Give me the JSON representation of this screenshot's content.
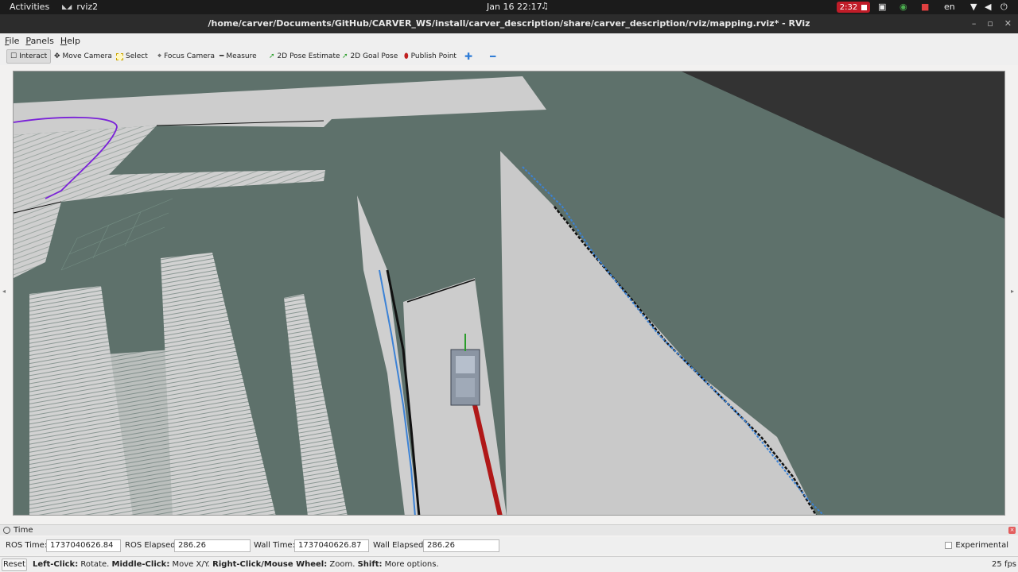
{
  "topbar": {
    "activities": "Activities",
    "app_name": "rviz2",
    "clock": "Jan 16  22:17",
    "recording": "2:32",
    "language": "en"
  },
  "window": {
    "title": "/home/carver/Documents/GitHub/CARVER_WS/install/carver_description/share/carver_description/rviz/mapping.rviz* - RViz"
  },
  "menubar": {
    "file": "File",
    "panels": "Panels",
    "help": "Help"
  },
  "toolbar": {
    "interact": "Interact",
    "move_camera": "Move Camera",
    "select": "Select",
    "focus_camera": "Focus Camera",
    "measure": "Measure",
    "pose_estimate": "2D Pose Estimate",
    "goal_pose": "2D Goal Pose",
    "publish_point": "Publish Point"
  },
  "time_panel": {
    "header": "Time",
    "ros_time_label": "ROS Time:",
    "ros_time": "1737040626.84",
    "ros_elapsed_label": "ROS Elapsed:",
    "ros_elapsed": "286.26",
    "wall_time_label": "Wall Time:",
    "wall_time": "1737040626.87",
    "wall_elapsed_label": "Wall Elapsed:",
    "wall_elapsed": "286.26",
    "experimental": "Experimental"
  },
  "statusbar": {
    "reset": "Reset",
    "left_click": "Left-Click:",
    "left_action": " Rotate. ",
    "middle_click": "Middle-Click:",
    "middle_action": " Move X/Y. ",
    "right_click": "Right-Click/Mouse Wheel:",
    "right_action": " Zoom. ",
    "shift": "Shift:",
    "shift_action": " More options.",
    "fps": "25 fps"
  },
  "colors": {
    "map_unknown": "#5e716b",
    "map_free": "#c9c9c9",
    "laser_scan": "#3b82d6",
    "path": "#7a22d8",
    "robot_trail": "#b01818"
  }
}
